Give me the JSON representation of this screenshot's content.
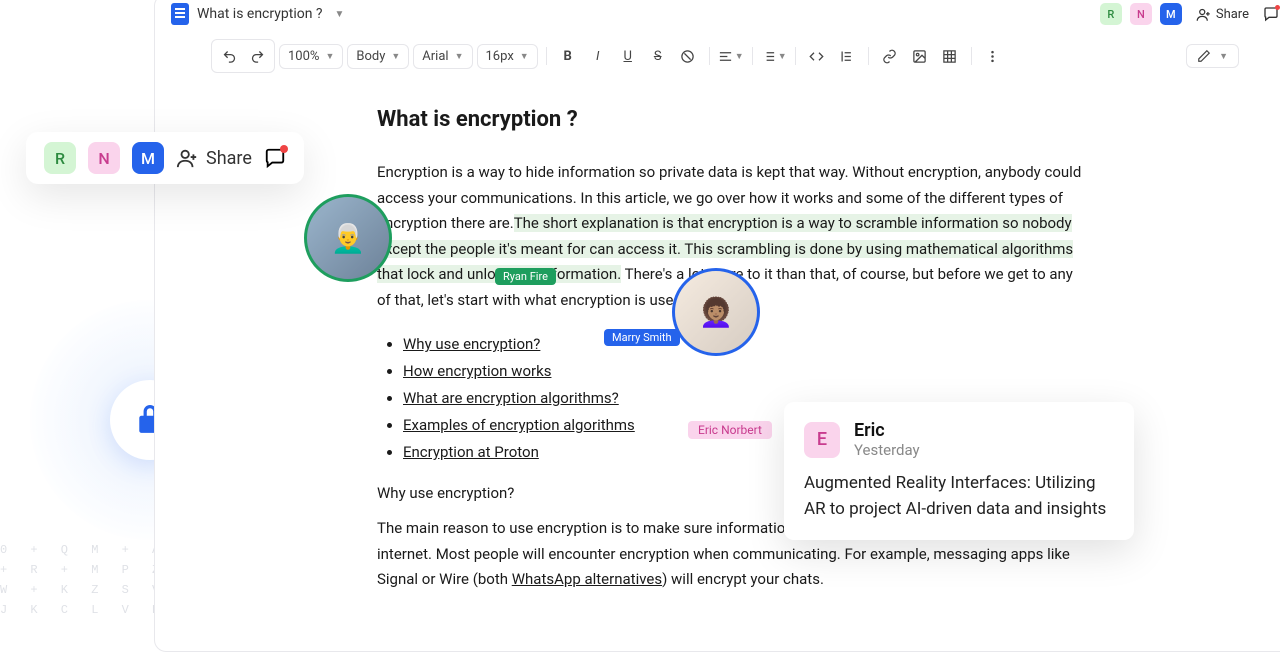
{
  "doc": {
    "title": "What is encryption ?",
    "heading": "What is encryption ?",
    "para1_a": "Encryption is a way to hide information so private data is kept that way. Without encryption, anybody could access your communications. In this article, we go over how it works and some of the different types of encryption there are.",
    "para1_hl": "The short explanation is that encryption is a way to scramble information so nobody except the people it's meant for can access it. This scrambling is done by using mathematical algorithms that lock and unlock the information.",
    "para1_b": " There's a lot more to it than that, of course, but before we get to any of that, let's start with what encryption is used for.",
    "toc": [
      "Why use encryption?",
      "How encryption works",
      "What are encryption algorithms?",
      "Examples of encryption algorithms",
      "Encryption at Proton"
    ],
    "h3": "Why use encryption?",
    "para2_a": "The main reason to use encryption is to make sure information stays private even as it travels through the internet. Most people will encounter encryption when communicating. For example, messaging apps like Signal or Wire (both ",
    "para2_link": "WhatsApp alternatives",
    "para2_b": ") will encrypt your chats."
  },
  "toolbar": {
    "zoom": "100%",
    "style": "Body",
    "font": "Arial",
    "size": "16px"
  },
  "collaborators": {
    "r": "R",
    "n": "N",
    "m": "M",
    "ryan": "Ryan Fire",
    "marry": "Marry Smith",
    "eric": "Eric Norbert"
  },
  "share_label": "Share",
  "comment": {
    "initial": "E",
    "name": "Eric",
    "time": "Yesterday",
    "body": "Augmented Reality Interfaces: Utilizing AR to project AI-driven data and insights"
  }
}
